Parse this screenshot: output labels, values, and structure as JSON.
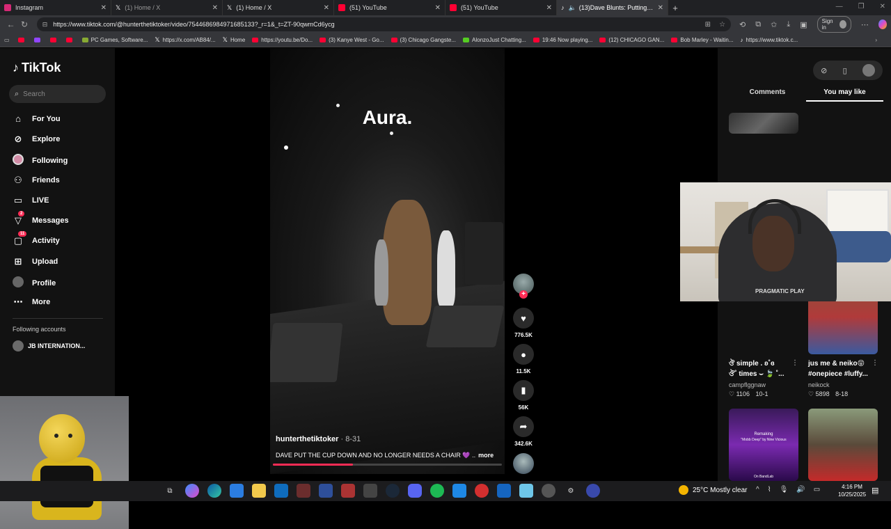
{
  "browser": {
    "tabs": [
      {
        "label": "Instagram",
        "color": "#d62976"
      },
      {
        "label": "(1) Home / X",
        "color": "#000000"
      },
      {
        "label": "(1) Home / X",
        "color": "#000000"
      },
      {
        "label": "(51) YouTube",
        "color": "#ff0033"
      },
      {
        "label": "(51) YouTube",
        "color": "#ff0033"
      },
      {
        "label": "(13)Dave Blunts: Putting Do",
        "color": "#000000"
      }
    ],
    "url": "https://www.tiktok.com/@hunterthetiktoker/video/7544686984971685133?_r=1&_t=ZT-90qwmCd6ycg",
    "signin_label": "Sign in",
    "bookmarks": [
      {
        "label": "",
        "icon": "yt"
      },
      {
        "label": "",
        "icon": "twitch"
      },
      {
        "label": "",
        "icon": "yt"
      },
      {
        "label": "",
        "icon": "yt"
      },
      {
        "label": "PC Games, Software...",
        "icon": "pc"
      },
      {
        "label": "https://x.com/AB84/...",
        "icon": "x"
      },
      {
        "label": "Home",
        "icon": "x"
      },
      {
        "label": "https://youtu.be/Do...",
        "icon": "yt"
      },
      {
        "label": "(3) Kanye West - Go...",
        "icon": "yt"
      },
      {
        "label": "(3) Chicago Gangste...",
        "icon": "yt"
      },
      {
        "label": "AlonzoJust Chatting...",
        "icon": "kick"
      },
      {
        "label": "19:46 Now playing...",
        "icon": "yt"
      },
      {
        "label": "(12) CHICAGO GAN...",
        "icon": "yt"
      },
      {
        "label": "Bob Marley - Waitin...",
        "icon": "yt"
      },
      {
        "label": "https://www.tiktok.c...",
        "icon": "tt"
      }
    ]
  },
  "sidebar": {
    "logo": "TikTok",
    "search_placeholder": "Search",
    "items": [
      {
        "label": "For You",
        "icon": "home-icon"
      },
      {
        "label": "Explore",
        "icon": "compass-icon"
      },
      {
        "label": "Following",
        "icon": "following-avatar-icon"
      },
      {
        "label": "Friends",
        "icon": "friends-icon"
      },
      {
        "label": "LIVE",
        "icon": "live-icon"
      },
      {
        "label": "Messages",
        "icon": "messages-icon",
        "badge": "2"
      },
      {
        "label": "Activity",
        "icon": "activity-icon",
        "badge": "11"
      },
      {
        "label": "Upload",
        "icon": "upload-icon"
      },
      {
        "label": "Profile",
        "icon": "profile-avatar-icon"
      },
      {
        "label": "More",
        "icon": "more-icon"
      }
    ],
    "following_header": "Following accounts",
    "following_first": "JB INTERNATION..."
  },
  "video": {
    "overlay_text": "Aura.",
    "username": "hunterthetiktoker",
    "date": "· 8-31",
    "description": "DAVE PUT THE CUP DOWN AND NO LONGER NEEDS A CHAIR 💜 ..",
    "more": "more",
    "progress": 0.35
  },
  "actions": {
    "likes": "776.5K",
    "comments": "11.5K",
    "saves": "56K",
    "shares": "342.6K"
  },
  "right_panel": {
    "tab_comments": "Comments",
    "tab_may_like": "You may like",
    "cards": [
      {
        "title1": "ঔ simple . ʚ˚ɞ",
        "title2": "ঔ˚ times ⌣ 🍃 ˚...",
        "user": "campflggnaw",
        "likes": "1106",
        "date": "10-1"
      },
      {
        "title1": "jus me & neiko😝",
        "title2": "#onepiece #luffy...",
        "user": "neikock",
        "likes": "5898",
        "date": "8-18"
      }
    ],
    "bottom_card_text1": "Remaking",
    "bottom_card_text2": "\"Mobb Deep\" by Nine Vicious",
    "bottom_card_text3": "On BandLab"
  },
  "facecam": {
    "brand": "PRAGMATIC PLAY"
  },
  "taskbar": {
    "weather": "25°C  Mostly clear",
    "time": "4:16 PM",
    "date": "10/25/2025"
  }
}
